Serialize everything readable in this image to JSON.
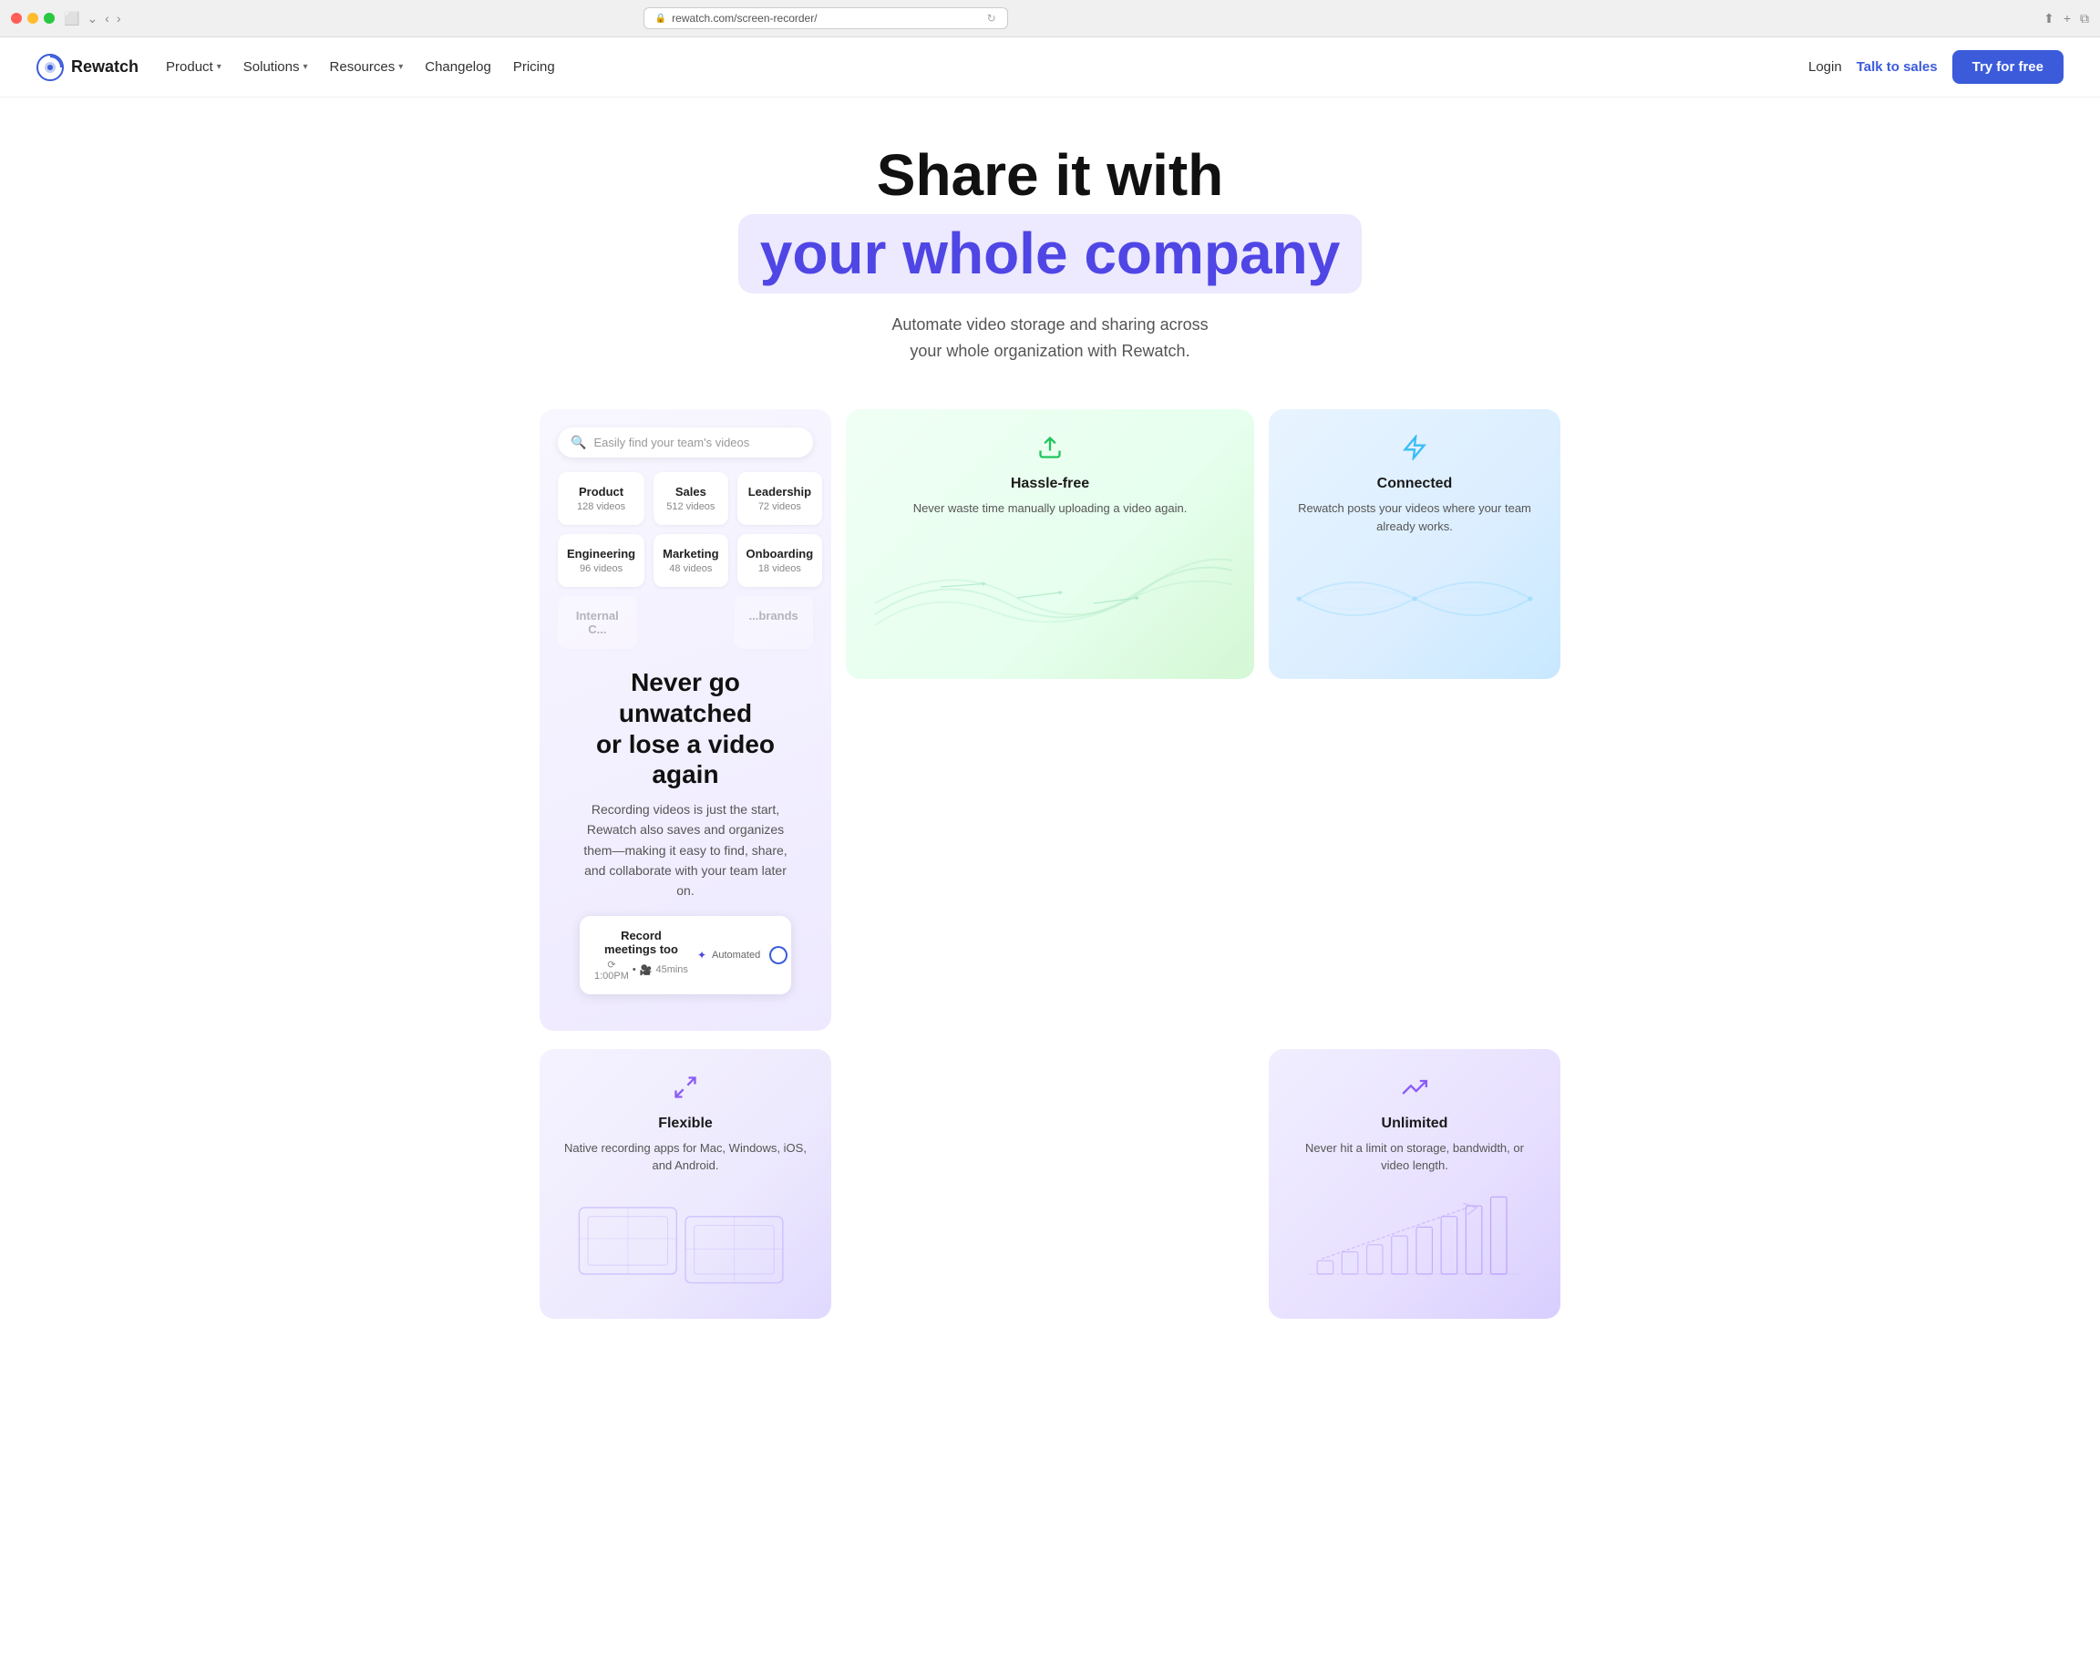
{
  "browser": {
    "url": "rewatch.com/screen-recorder/"
  },
  "nav": {
    "logo_text": "Rewatch",
    "links": [
      {
        "label": "Product",
        "has_dropdown": true
      },
      {
        "label": "Solutions",
        "has_dropdown": true
      },
      {
        "label": "Resources",
        "has_dropdown": true
      },
      {
        "label": "Changelog",
        "has_dropdown": false
      },
      {
        "label": "Pricing",
        "has_dropdown": false
      }
    ],
    "login": "Login",
    "talk_sales": "Talk to sales",
    "try_free": "Try for free"
  },
  "hero": {
    "title_line1": "Share it with",
    "title_line2": "your whole company",
    "subtitle": "Automate video storage and sharing across\nyour whole organization with Rewatch."
  },
  "cards": {
    "hassle_free": {
      "title": "Hassle-free",
      "desc": "Never waste time manually uploading a video again."
    },
    "connected": {
      "title": "Connected",
      "desc": "Rewatch posts your videos where your team already works."
    },
    "flexible": {
      "title": "Flexible",
      "desc": "Native recording apps for Mac, Windows, iOS, and Android."
    },
    "unlimited": {
      "title": "Unlimited",
      "desc": "Never hit a limit on storage, bandwidth, or video length."
    }
  },
  "library": {
    "search_placeholder": "Easily find your team's videos",
    "categories": [
      {
        "name": "Product",
        "count": "128 videos"
      },
      {
        "name": "Sales",
        "count": "512 videos"
      },
      {
        "name": "Leadership",
        "count": "72 videos"
      },
      {
        "name": "Engineering",
        "count": "96 videos"
      },
      {
        "name": "Marketing",
        "count": "48 videos"
      },
      {
        "name": "Onboarding",
        "count": "18 videos"
      }
    ],
    "partial_row": [
      "Internal C...",
      "...brands"
    ]
  },
  "mid_section": {
    "title": "Never go unwatched\nor lose a video again",
    "desc": "Recording videos is just the start, Rewatch also saves and organizes them—making it easy to find, share, and collaborate with your team later on.",
    "record_card": {
      "title": "Record meetings too",
      "time": "⟳ 1:00PM",
      "duration": "45mins",
      "automated_label": "Automated",
      "toggle_on": true
    }
  }
}
